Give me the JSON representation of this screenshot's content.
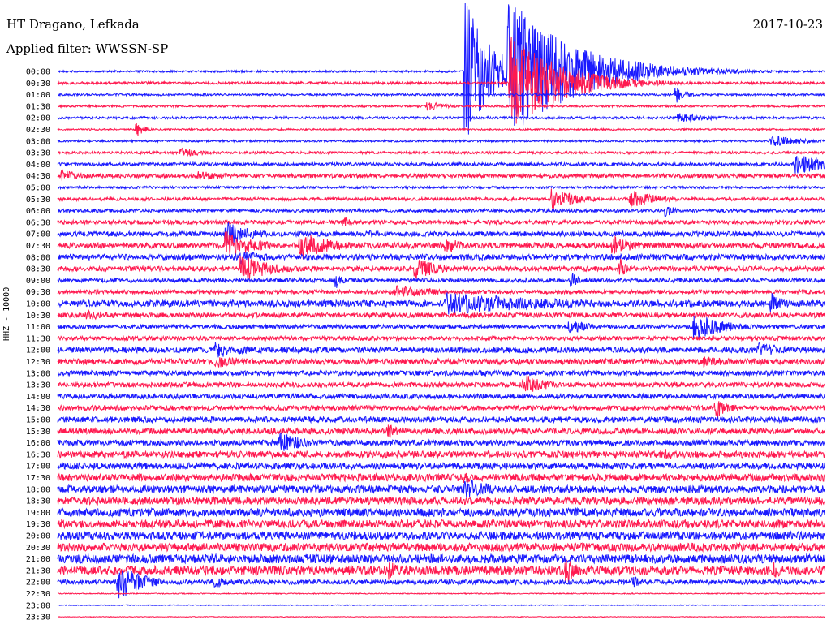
{
  "header": {
    "station": "HT Dragano, Lefkada",
    "date": "2017-10-23",
    "filter": "Applied filter: WWSSN-SP",
    "channel": "HHZ - 10000"
  },
  "colors": {
    "trace_a": "#1a1aff",
    "trace_b": "#ff1a50",
    "background": "#ffffff",
    "text": "#000000"
  },
  "chart_data": {
    "type": "helicorder",
    "x_unit": "minutes past row start",
    "xlim": [
      0,
      30
    ],
    "row_labels": [
      "00:00",
      "00:30",
      "01:00",
      "01:30",
      "02:00",
      "02:30",
      "03:00",
      "03:30",
      "04:00",
      "04:30",
      "05:00",
      "05:30",
      "06:00",
      "06:30",
      "07:00",
      "07:30",
      "08:00",
      "08:30",
      "09:00",
      "09:30",
      "10:00",
      "10:30",
      "11:00",
      "11:30",
      "12:00",
      "12:30",
      "13:00",
      "13:30",
      "14:00",
      "14:30",
      "15:00",
      "15:30",
      "16:00",
      "16:30",
      "17:00",
      "17:30",
      "18:00",
      "18:30",
      "19:00",
      "19:30",
      "20:00",
      "20:30",
      "21:00",
      "21:30",
      "22:00",
      "22:30",
      "23:00",
      "23:30"
    ],
    "color_cycle": [
      "trace_a",
      "trace_b"
    ],
    "noise_level": [
      1.2,
      1.6,
      1.3,
      1.2,
      1.5,
      1.0,
      1.2,
      1.5,
      2.0,
      2.5,
      1.5,
      2.0,
      2.0,
      2.5,
      3.0,
      3.5,
      3.5,
      3.0,
      2.5,
      2.5,
      4.0,
      3.0,
      2.5,
      2.5,
      3.5,
      3.5,
      3.0,
      3.0,
      3.0,
      3.0,
      3.5,
      3.5,
      3.5,
      4.0,
      4.0,
      4.5,
      4.5,
      4.5,
      5.0,
      5.0,
      5.0,
      5.0,
      5.5,
      5.5,
      3.0,
      0.6,
      0.5,
      0.4
    ],
    "events": [
      {
        "row": 0,
        "minute": 15.95,
        "amplitude": 90,
        "duration": 1.0
      },
      {
        "row": 0,
        "minute": 17.65,
        "amplitude": 90,
        "duration": 2.5
      },
      {
        "row": 1,
        "minute": 17.7,
        "amplitude": 60,
        "duration": 2.0
      },
      {
        "row": 2,
        "minute": 24.2,
        "amplitude": 10,
        "duration": 0.4
      },
      {
        "row": 3,
        "minute": 14.5,
        "amplitude": 6,
        "duration": 0.8
      },
      {
        "row": 4,
        "minute": 24.3,
        "amplitude": 6,
        "duration": 1.5
      },
      {
        "row": 5,
        "minute": 3.1,
        "amplitude": 10,
        "duration": 0.3
      },
      {
        "row": 6,
        "minute": 27.9,
        "amplitude": 8,
        "duration": 1.2
      },
      {
        "row": 7,
        "minute": 4.8,
        "amplitude": 6,
        "duration": 1.0
      },
      {
        "row": 8,
        "minute": 28.9,
        "amplitude": 12,
        "duration": 2.0
      },
      {
        "row": 9,
        "minute": 0.2,
        "amplitude": 8,
        "duration": 0.8
      },
      {
        "row": 9,
        "minute": 5.5,
        "amplitude": 6,
        "duration": 1.5
      },
      {
        "row": 11,
        "minute": 19.3,
        "amplitude": 14,
        "duration": 1.0
      },
      {
        "row": 11,
        "minute": 22.4,
        "amplitude": 14,
        "duration": 1.0
      },
      {
        "row": 12,
        "minute": 23.8,
        "amplitude": 10,
        "duration": 0.3
      },
      {
        "row": 13,
        "minute": 11.2,
        "amplitude": 9,
        "duration": 0.3
      },
      {
        "row": 14,
        "minute": 6.6,
        "amplitude": 16,
        "duration": 1.0
      },
      {
        "row": 14,
        "minute": 12.1,
        "amplitude": 8,
        "duration": 0.3
      },
      {
        "row": 15,
        "minute": 6.6,
        "amplitude": 18,
        "duration": 1.2
      },
      {
        "row": 15,
        "minute": 9.5,
        "amplitude": 18,
        "duration": 1.3
      },
      {
        "row": 15,
        "minute": 15.2,
        "amplitude": 10,
        "duration": 0.8
      },
      {
        "row": 15,
        "minute": 21.7,
        "amplitude": 12,
        "duration": 1.0
      },
      {
        "row": 16,
        "minute": 7.2,
        "amplitude": 10,
        "duration": 1.0
      },
      {
        "row": 17,
        "minute": 7.2,
        "amplitude": 18,
        "duration": 1.2
      },
      {
        "row": 17,
        "minute": 14.0,
        "amplitude": 14,
        "duration": 1.0
      },
      {
        "row": 17,
        "minute": 22.0,
        "amplitude": 14,
        "duration": 0.3
      },
      {
        "row": 18,
        "minute": 10.9,
        "amplitude": 10,
        "duration": 0.3
      },
      {
        "row": 18,
        "minute": 20.1,
        "amplitude": 10,
        "duration": 0.3
      },
      {
        "row": 19,
        "minute": 13.2,
        "amplitude": 8,
        "duration": 2.0
      },
      {
        "row": 20,
        "minute": 15.2,
        "amplitude": 14,
        "duration": 5.0
      },
      {
        "row": 20,
        "minute": 27.9,
        "amplitude": 14,
        "duration": 0.4
      },
      {
        "row": 21,
        "minute": 1.2,
        "amplitude": 6,
        "duration": 1.5
      },
      {
        "row": 22,
        "minute": 20.0,
        "amplitude": 9,
        "duration": 1.0
      },
      {
        "row": 22,
        "minute": 24.9,
        "amplitude": 18,
        "duration": 1.2
      },
      {
        "row": 24,
        "minute": 6.2,
        "amplitude": 10,
        "duration": 1.5
      },
      {
        "row": 24,
        "minute": 27.4,
        "amplitude": 9,
        "duration": 1.5
      },
      {
        "row": 25,
        "minute": 6.2,
        "amplitude": 8,
        "duration": 1.5
      },
      {
        "row": 25,
        "minute": 25.3,
        "amplitude": 8,
        "duration": 1.2
      },
      {
        "row": 27,
        "minute": 18.2,
        "amplitude": 16,
        "duration": 0.8
      },
      {
        "row": 29,
        "minute": 25.7,
        "amplitude": 14,
        "duration": 0.6
      },
      {
        "row": 31,
        "minute": 12.9,
        "amplitude": 12,
        "duration": 0.4
      },
      {
        "row": 32,
        "minute": 8.7,
        "amplitude": 14,
        "duration": 1.0
      },
      {
        "row": 33,
        "minute": 23.8,
        "amplitude": 8,
        "duration": 0.4
      },
      {
        "row": 35,
        "minute": 15.9,
        "amplitude": 8,
        "duration": 0.5
      },
      {
        "row": 36,
        "minute": 15.9,
        "amplitude": 16,
        "duration": 1.0
      },
      {
        "row": 43,
        "minute": 13.0,
        "amplitude": 12,
        "duration": 0.5
      },
      {
        "row": 43,
        "minute": 19.9,
        "amplitude": 16,
        "duration": 0.6
      },
      {
        "row": 43,
        "minute": 28.0,
        "amplitude": 12,
        "duration": 0.4
      },
      {
        "row": 44,
        "minute": 2.4,
        "amplitude": 22,
        "duration": 1.0
      },
      {
        "row": 44,
        "minute": 6.2,
        "amplitude": 8,
        "duration": 0.4
      },
      {
        "row": 44,
        "minute": 22.5,
        "amplitude": 10,
        "duration": 0.3
      }
    ]
  }
}
